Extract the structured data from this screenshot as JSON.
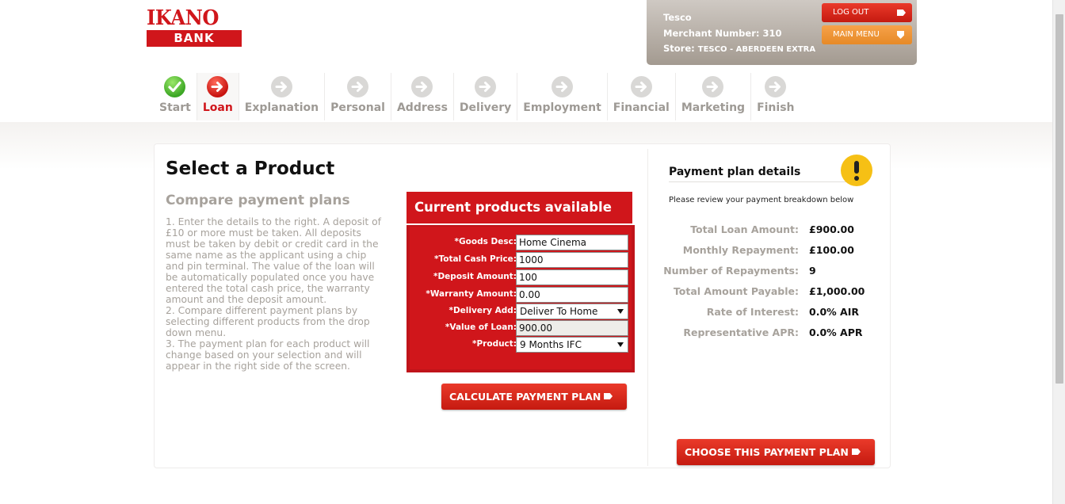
{
  "logo": {
    "top": "IKANO",
    "bottom": "BANK"
  },
  "merchant": {
    "name": "Tesco",
    "number_label": "Merchant Number:",
    "number": "310",
    "store_label": "Store:",
    "store": "TESCO - ABERDEEN EXTRA",
    "logout_label": "LOG OUT",
    "mainmenu_label": "MAIN MENU"
  },
  "steps": [
    {
      "label": "Start",
      "state": "done"
    },
    {
      "label": "Loan",
      "state": "current"
    },
    {
      "label": "Explanation",
      "state": "todo"
    },
    {
      "label": "Personal",
      "state": "todo"
    },
    {
      "label": "Address",
      "state": "todo"
    },
    {
      "label": "Delivery",
      "state": "todo"
    },
    {
      "label": "Employment",
      "state": "todo"
    },
    {
      "label": "Financial",
      "state": "todo"
    },
    {
      "label": "Marketing",
      "state": "todo"
    },
    {
      "label": "Finish",
      "state": "todo"
    }
  ],
  "main": {
    "title": "Select a Product",
    "subtitle": "Compare payment plans",
    "instructions": [
      "1. Enter the details to the right. A deposit of £10 or more must be taken. All deposits must be taken by debit or credit card in the same name as the applicant using a chip and pin terminal. The value of the loan will be automatically populated once you have entered the total cash price, the warranty amount and the deposit amount.",
      "2. Compare different payment plans by selecting different products from the drop down menu.",
      "3. The payment plan for each product will change based on your selection and will appear in the right side of the screen."
    ]
  },
  "products": {
    "heading": "Current products available",
    "fields": {
      "goods_desc": {
        "label": "*Goods Desc:",
        "value": "Home Cinema"
      },
      "total_cash_price": {
        "label": "*Total Cash Price:",
        "value": "1000"
      },
      "deposit_amount": {
        "label": "*Deposit Amount:",
        "value": "100"
      },
      "warranty_amount": {
        "label": "*Warranty Amount:",
        "value": "0.00"
      },
      "delivery_add": {
        "label": "*Delivery Add:",
        "value": "Deliver To Home"
      },
      "value_of_loan": {
        "label": "*Value of Loan:",
        "value": "900.00"
      },
      "product": {
        "label": "*Product:",
        "value": "9 Months IFC"
      }
    },
    "calculate_label": "CALCULATE PAYMENT PLAN"
  },
  "payment_plan": {
    "title": "Payment plan details",
    "note": "Please review your payment breakdown below",
    "rows": [
      {
        "label": "Total Loan Amount:",
        "value": "£900.00"
      },
      {
        "label": "Monthly Repayment:",
        "value": "£100.00"
      },
      {
        "label": "Number of Repayments:",
        "value": "9"
      },
      {
        "label": "Total Amount Payable:",
        "value": "£1,000.00"
      },
      {
        "label": "Rate of Interest:",
        "value": "0.0% AIR"
      },
      {
        "label": "Representative APR:",
        "value": "0.0% APR"
      }
    ],
    "choose_label": "CHOOSE THIS PAYMENT PLAN"
  },
  "colors": {
    "brand_red": "#d0161b",
    "accent_orange": "#e68a27",
    "muted_text": "#a7a29c",
    "warning_yellow": "#f6c015"
  }
}
